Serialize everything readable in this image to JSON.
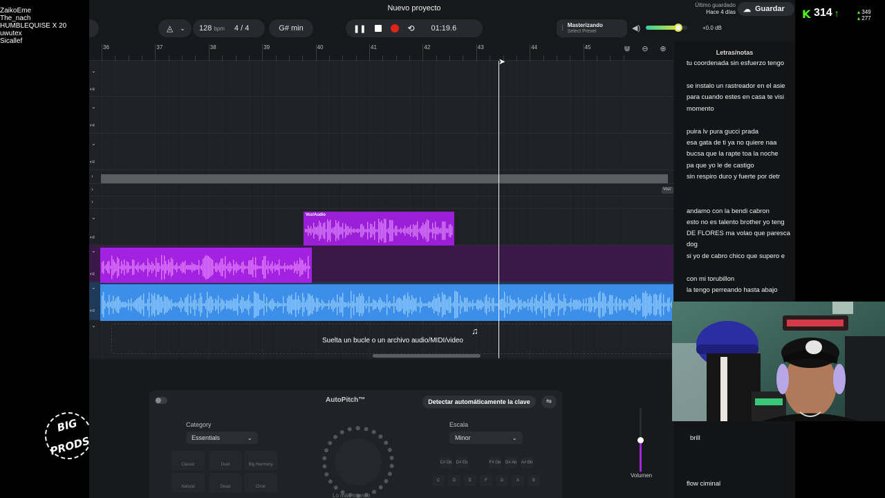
{
  "chat": {
    "users": [
      "ZaikoEme",
      "The_nach",
      "HUMBLEQUISE X 20",
      "uwutex",
      "Sicallef"
    ]
  },
  "logo": {
    "text_line1": "BIG",
    "text_line2": "PRODS"
  },
  "stream": {
    "viewer_count": "314",
    "stat_up": "349",
    "stat_down": "277"
  },
  "app": {
    "project_title": "Nuevo proyecto",
    "saved_label": "Último guardado",
    "saved_value": "Hace 4 días",
    "save_button": "Guardar",
    "tempo": {
      "value": "128",
      "unit": "bpm"
    },
    "time_signature": "4 / 4",
    "key": "G# min",
    "time_display": "01:19.6",
    "mastering": {
      "title": "Masterizando",
      "subtitle": "Select Preset"
    },
    "master_volume": "+0.0 dB",
    "master_volume_level": 0.78,
    "ruler": {
      "bars": [
        "36",
        "37",
        "38",
        "39",
        "40",
        "41",
        "42",
        "43",
        "44",
        "45"
      ]
    },
    "clips": [
      {
        "label": "Voz/Audio",
        "color": "#9b1fd6"
      },
      {
        "label": "",
        "color": "#a321e0"
      },
      {
        "label": "",
        "color": "#3d8ee8"
      }
    ],
    "right_clip_label": "Voz/",
    "drop_zone": "Suelta un bucle o un archivo audio/MIDI/video",
    "autopitch": {
      "title": "AutoPitch™",
      "detect_button": "Detectar automáticamente la clave",
      "category_label": "Category",
      "category_value": "Essentials",
      "scale_label": "Escala",
      "scale_value": "Minor",
      "modes": [
        "Classic",
        "Duet",
        "Big Harmony",
        "Natural",
        "Dead",
        "Choir"
      ],
      "keys_row1": [
        "C#\nDb",
        "D#\nEb",
        "F#\nGb",
        "G#\nAb",
        "A#\nBb"
      ],
      "keys_row2": [
        "C",
        "D",
        "E",
        "F",
        "G",
        "A",
        "B"
      ],
      "knob_label": "Lo más intenso",
      "volume_label": "Volumen"
    }
  },
  "lyrics": {
    "title": "Letras/notas",
    "lines": [
      "tu coordenada sin esfuerzo tengo",
      "",
      "se instalo un rastreador en el asie",
      "para cuando estes en casa te visi",
      "momento",
      "",
      "puira lv pura gucci prada",
      "esa gata de ti ya no quiere naa",
      "bucsa que la rapte toa la noche",
      "pa que yo le de castigo",
      "sin respiro duro y fuerte   por detr",
      "",
      "",
      "andamo con la bendi cabron",
      "esto no es talento brother yo teng",
      " DE FLORES ma volao que paresca",
      "dog",
      "si yo de cabro chico que supero e",
      "",
      "con mi torubillon",
      "la tengo perreando hasta abajo"
    ],
    "after_cam": [
      "brill",
      "flow ciminal"
    ]
  }
}
